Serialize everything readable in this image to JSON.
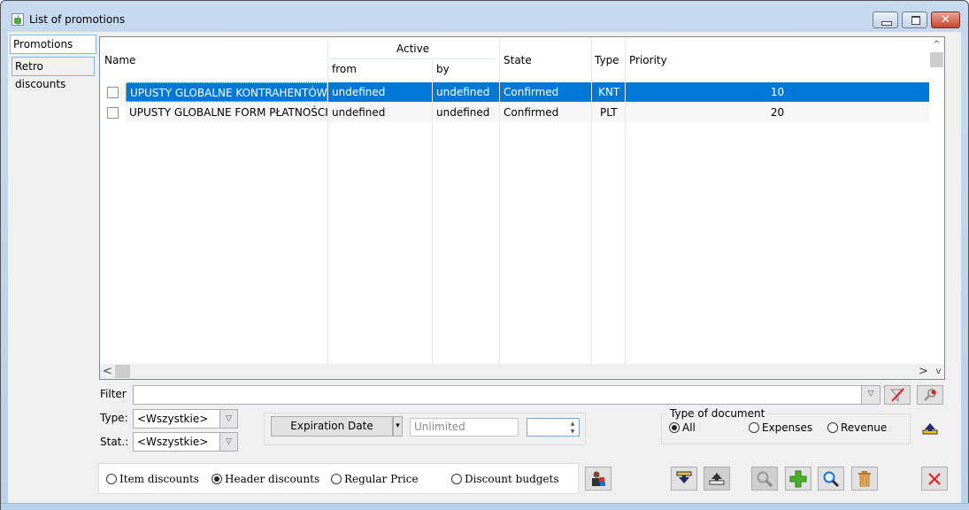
{
  "window": {
    "title": "List of promotions",
    "controls": {
      "minimize": "minimize",
      "maximize": "maximize",
      "close": "✕"
    }
  },
  "side_tabs": [
    {
      "label": "Promotions",
      "active": true
    },
    {
      "label": "Retro discounts",
      "active": false
    }
  ],
  "grid": {
    "headers": {
      "name": "Name",
      "active_group": "Active",
      "from": "from",
      "by": "by",
      "state": "State",
      "type": "Type",
      "priority": "Priority"
    },
    "rows": [
      {
        "checked": false,
        "name": "UPUSTY GLOBALNE KONTRAHENTÓW",
        "from": "undefined",
        "by": "undefined",
        "state": "Confirmed",
        "type": "KNT",
        "priority": "10",
        "selected": true
      },
      {
        "checked": false,
        "name": "UPUSTY GLOBALNE FORM PŁATNOŚCI",
        "from": "undefined",
        "by": "undefined",
        "state": "Confirmed",
        "type": "PLT",
        "priority": "20",
        "selected": false
      }
    ],
    "scroll": {
      "up": "^",
      "left": "<",
      "right": ">",
      "down": "v"
    }
  },
  "filter": {
    "label": "Filter",
    "value": "",
    "clear_icon": "filter-clear-icon",
    "settings_icon": "filter-settings-icon"
  },
  "type_combo": {
    "label": "Type:",
    "value": "<Wszystkie>"
  },
  "stat_combo": {
    "label": "Stat.:",
    "value": "<Wszystkie>"
  },
  "expiration": {
    "button_label": "Expiration Date",
    "dropdown_arrow": "▾",
    "value_placeholder": "Unlimited",
    "spin_value": ""
  },
  "document_type": {
    "legend": "Type of document",
    "options": [
      {
        "label": "All",
        "selected": true
      },
      {
        "label": "Expenses",
        "selected": false
      },
      {
        "label": "Revenue",
        "selected": false
      }
    ]
  },
  "discount_modes": {
    "options": [
      {
        "label": "Item discounts",
        "selected": false
      },
      {
        "label": "Header discounts",
        "selected": true
      },
      {
        "label": "Regular Price",
        "selected": false
      },
      {
        "label": "Discount budgets",
        "selected": false
      }
    ]
  },
  "toolbar": {
    "import_icon": "▼",
    "export_icon": "▲",
    "preview_icon": "🔍",
    "add_icon": "+",
    "search_icon": "🔍",
    "delete_icon": "🗑",
    "close_icon": "✕",
    "upload_icon": "▲",
    "assign_icon": "👤"
  },
  "colors": {
    "selection": "#0078d7",
    "title_bar": "#c6d9ee",
    "close_button": "#c7442c",
    "add_green": "#4caf2a",
    "close_red": "#e02020"
  }
}
